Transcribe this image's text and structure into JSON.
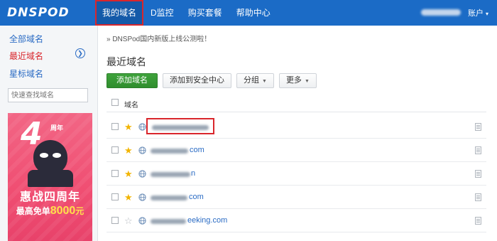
{
  "app": {
    "logo": "DNSPOD",
    "nav": [
      "我的域名",
      "D监控",
      "购买套餐",
      "帮助中心"
    ],
    "account_label": "账户",
    "account_caret": "▾"
  },
  "sidebar": {
    "items": [
      "全部域名",
      "最近域名",
      "星标域名"
    ],
    "current_index": 1,
    "search_placeholder": "快速查找域名",
    "banner": {
      "badge": "4",
      "badge_tag": "周年",
      "headline": "惠战四周年",
      "sub_prefix": "最高免单",
      "sub_amount": "8000",
      "sub_unit": "元"
    }
  },
  "main": {
    "notice": "» DNSPod国内新版上线公测啦！",
    "title": "最近域名",
    "buttons": {
      "add": "添加域名",
      "add_security": "添加到安全中心",
      "group": "分组",
      "more": "更多"
    },
    "column_header": "域名",
    "rows": [
      {
        "domain_visible": "",
        "starred": true,
        "highlighted": true
      },
      {
        "domain_visible": "com",
        "starred": true,
        "highlighted": false
      },
      {
        "domain_visible": "n",
        "starred": true,
        "highlighted": false
      },
      {
        "domain_visible": "com",
        "starred": true,
        "highlighted": false
      },
      {
        "domain_visible": "eeking.com",
        "starred": false,
        "highlighted": false
      }
    ]
  },
  "colors": {
    "header": "#1b6bc6",
    "highlight": "#d9262c",
    "link": "#2a6bc4",
    "primary_button": "#2f8d2d",
    "star": "#f2b400"
  }
}
